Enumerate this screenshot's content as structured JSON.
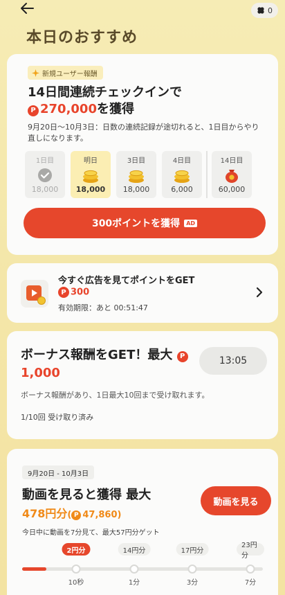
{
  "top_bar": {
    "coin_count": "0"
  },
  "page_title": "本日のおすすめ",
  "checkin_card": {
    "tag": "新規ユーザー報酬",
    "headline_line1": "14日間連続チェックインで",
    "headline_amount": "270,000",
    "headline_suffix": "を獲得",
    "currency_symbol": "P",
    "description": "9月20日〜10月3日：日数の連続記録が途切れると、1日目からやり直しになります。",
    "days": [
      {
        "label": "1日目",
        "value": "18,000",
        "state": "done",
        "icon": "check-icon"
      },
      {
        "label": "明日",
        "value": "18,000",
        "state": "active",
        "icon": "coin-stack-icon"
      },
      {
        "label": "3日目",
        "value": "18,000",
        "state": "future",
        "icon": "coin-stack-icon"
      },
      {
        "label": "4日目",
        "value": "6,000",
        "state": "future",
        "icon": "coin-stack-icon"
      },
      {
        "label": "14日目",
        "value": "60,000",
        "state": "future",
        "icon": "money-bag-icon"
      }
    ],
    "button_label": "300ポイントを獲得",
    "ad_badge": "AD"
  },
  "ad_card": {
    "title": "今すぐ広告を見てポイントをGET",
    "points": "300",
    "expiry": "有効期限：あと 00:51:47"
  },
  "bonus_card": {
    "headline": "ボーナス報酬をGET！最大",
    "amount": "1,000",
    "timer": "13:05",
    "description": "ボーナス報酬があり、1日最大10回まで受け取れます。",
    "count": "1/10回 受け取り済み"
  },
  "video_card": {
    "date_range": "9月20日 - 10月3日",
    "title": "動画を見ると獲得 最大",
    "amount_yen": "478円分",
    "amount_open": "(",
    "amount_points": "47,860",
    "amount_close": ")",
    "button_label": "動画を見る",
    "description": "今日中に動画を7分見て、最大57円分ゲット",
    "progress_fraction": 0.1,
    "milestones": [
      {
        "reward": "2円分",
        "time": "10秒",
        "active": true
      },
      {
        "reward": "14円分",
        "time": "1分",
        "active": false
      },
      {
        "reward": "17円分",
        "time": "3分",
        "active": false
      },
      {
        "reward": "23円分",
        "time": "7分",
        "active": false
      }
    ]
  },
  "colors": {
    "accent": "#e6472c",
    "orange": "#f08a18",
    "background": "#f6ecb5"
  }
}
